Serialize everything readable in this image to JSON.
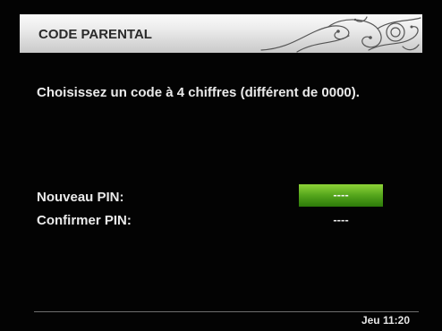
{
  "header": {
    "title": "CODE PARENTAL",
    "ornament_icon": "swirl-ornament-icon"
  },
  "instruction": "Choisissez un code à 4 chiffres (différent de 0000).",
  "form": {
    "new_pin_label": "Nouveau PIN:",
    "new_pin_value": "----",
    "confirm_pin_label": "Confirmer PIN:",
    "confirm_pin_value": "----"
  },
  "status_bar": {
    "clock": "Jeu 11:20"
  },
  "colors": {
    "background": "#030303",
    "header_light": "#fbfbfb",
    "header_dark": "#c9c9c9",
    "focus_green": "#54a51c",
    "text": "#eaeaea"
  }
}
